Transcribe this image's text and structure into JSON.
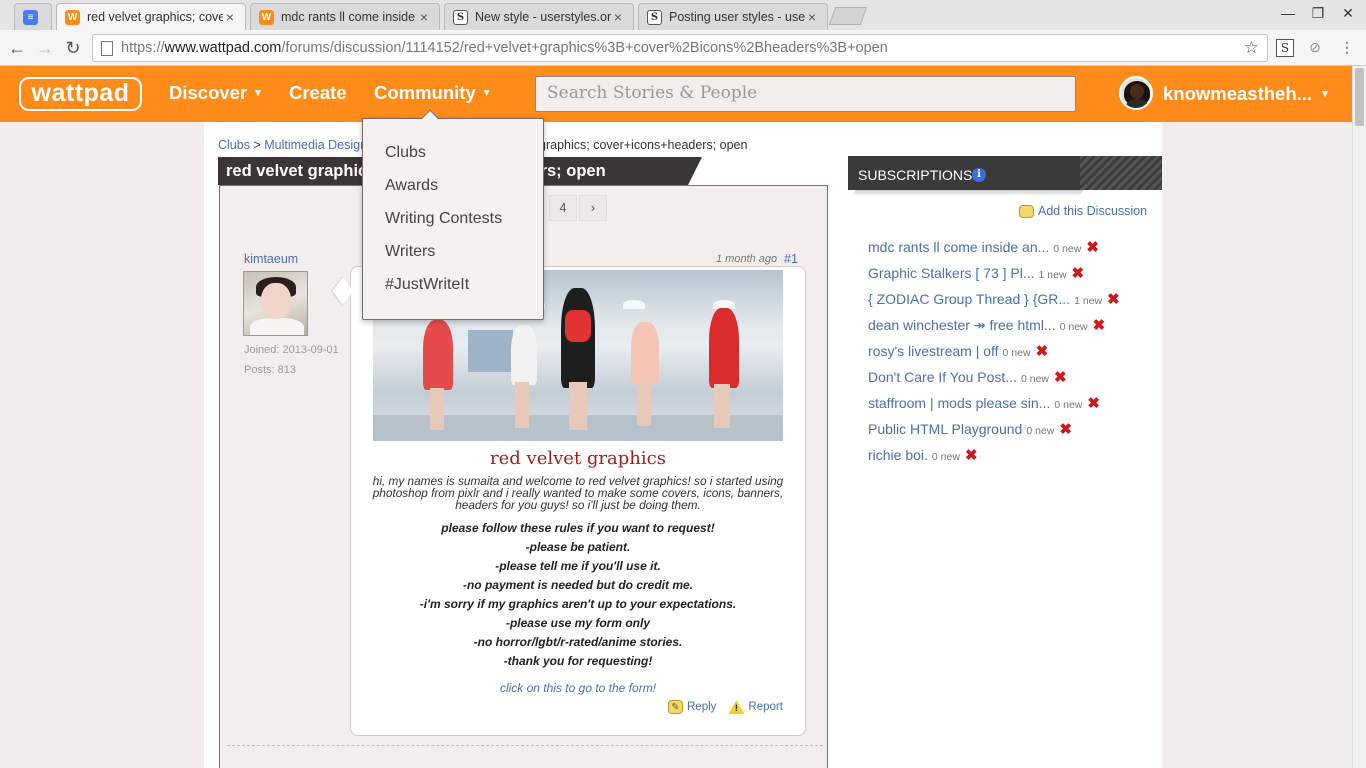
{
  "browser": {
    "tabs": [
      {
        "label": "",
        "icon": "docs-icon"
      },
      {
        "label": "red velvet graphics; cove",
        "icon": "wattpad-icon"
      },
      {
        "label": "mdc rants ll come inside",
        "icon": "wattpad-icon"
      },
      {
        "label": "New style - userstyles.or",
        "icon": "userstyles-icon"
      },
      {
        "label": "Posting user styles - use",
        "icon": "userstyles-icon"
      }
    ],
    "url_scheme": "https://",
    "url_host": "www.wattpad.com",
    "url_path": "/forums/discussion/1114152/red+velvet+graphics%3B+cover%2Bicons%2Bheaders%3B+open"
  },
  "header": {
    "logo": "wattpad",
    "nav": {
      "discover": "Discover",
      "create": "Create",
      "community": "Community"
    },
    "search_placeholder": "Search Stories & People",
    "username": "knowmeastheh..."
  },
  "community_menu": [
    "Clubs",
    "Awards",
    "Writing Contests",
    "Writers",
    "#JustWriteIt"
  ],
  "breadcrumb": {
    "root": "Clubs",
    "sep": " > ",
    "section": "Multimedia Design",
    "rest": "graphics; cover+icons+headers; open"
  },
  "thread": {
    "title": "red velvet graphics; cover+icons+headers; open",
    "pages": [
      "4",
      "›"
    ]
  },
  "post": {
    "author": "kimtaeum",
    "joined": "Joined: 2013-09-01",
    "posts": "Posts: 813",
    "time": "1 month ago",
    "number": "#1",
    "heading": "red velvet graphics",
    "intro": "hi, my names is sumaita and welcome to red velvet graphics! so i started using photoshop from pixlr and i really wanted to make some covers, icons, banners, headers for you guys! so i'll just be doing them.",
    "rules": [
      "please follow these rules if you want to request!",
      "-please be patient.",
      "-please tell me if you'll use it.",
      "-no payment is needed but do credit me.",
      "-i'm sorry if my graphics aren't up to your expectations.",
      "-please use my form only",
      "-no horror/lgbt/r-rated/anime stories.",
      "-thank you for requesting!"
    ],
    "form_link": "click on this to go to the form!",
    "reply": "Reply",
    "report": "Report"
  },
  "sidebar": {
    "title": "SUBSCRIPTIONS",
    "add": "Add this Discussion",
    "items": [
      {
        "label": "mdc rants ll come inside an...",
        "count": "0 new"
      },
      {
        "label": "Graphic Stalkers [ 73 ] Pl...",
        "count": "1 new"
      },
      {
        "label": "{ ZODIAC Group Thread } {GR...",
        "count": "1 new"
      },
      {
        "label": "dean winchester ↠ free html...",
        "count": "0 new"
      },
      {
        "label": "rosy's livestream | off",
        "count": "0 new"
      },
      {
        "label": "Don't Care If You Post...",
        "count": "0 new"
      },
      {
        "label": "staffroom | mods please sin...",
        "count": "0 new"
      },
      {
        "label": "Public HTML Playground",
        "count": "0 new"
      },
      {
        "label": "richie boi.",
        "count": "0 new"
      }
    ]
  },
  "colors": {
    "brand": "#ff8c1a",
    "link": "#4a6fb5",
    "title_red": "#a61c1c"
  }
}
